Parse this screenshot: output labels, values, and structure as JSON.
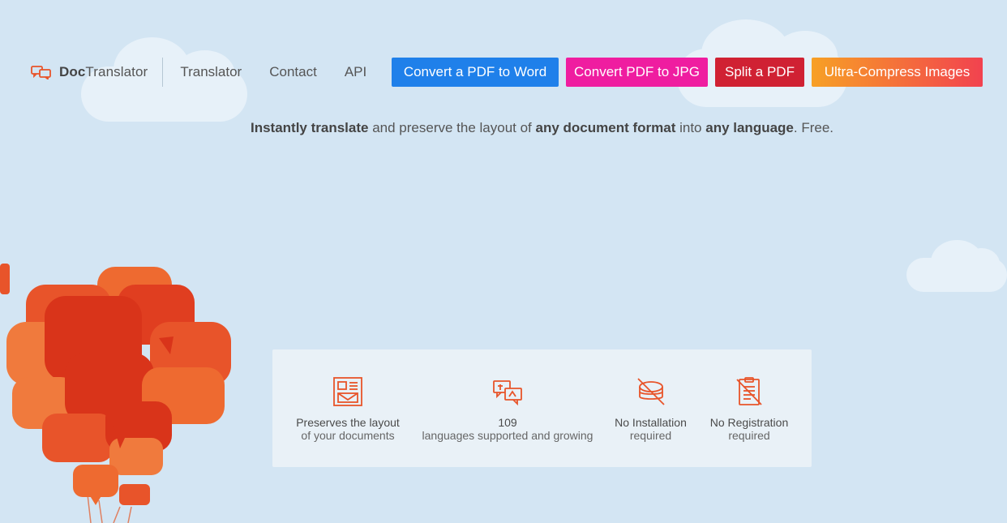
{
  "nav": {
    "brand_bold": "Doc",
    "brand_rest": "Translator",
    "links": [
      "Translator",
      "Contact",
      "API"
    ],
    "buttons": [
      {
        "label": "Convert a PDF to Word",
        "color": "#1f80ea"
      },
      {
        "label": "Convert PDF to JPG",
        "color": "#ef1da0"
      },
      {
        "label": "Split a PDF",
        "color": "#d02133"
      },
      {
        "label": "Ultra-Compress Images",
        "color": "#f56a47"
      }
    ]
  },
  "tagline": {
    "p1": "Instantly translate",
    "p2": " and preserve the layout of ",
    "p3": "any document format",
    "p4": " into ",
    "p5": "any language",
    "p6": ". Free."
  },
  "features": [
    {
      "title": "Preserves the layout",
      "subtitle": "of your documents",
      "icon": "document-layout-icon"
    },
    {
      "title": "109",
      "subtitle": "languages supported and growing",
      "icon": "translate-icon"
    },
    {
      "title": "No Installation",
      "subtitle": "required",
      "icon": "no-install-icon"
    },
    {
      "title": "No Registration",
      "subtitle": "required",
      "icon": "no-registration-icon"
    }
  ],
  "colors": {
    "background": "#d3e5f3",
    "accent": "#e8542a"
  }
}
